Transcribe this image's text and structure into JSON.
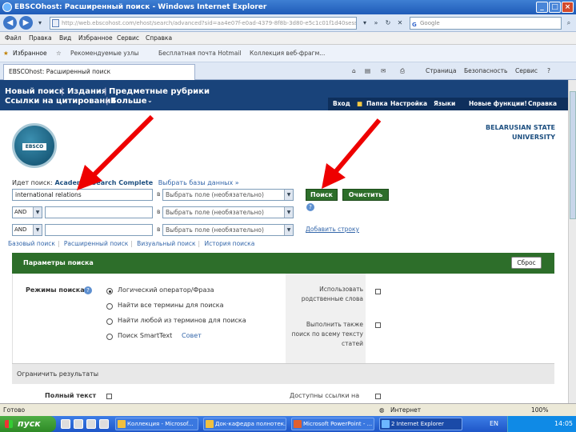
{
  "window": {
    "title": "EBSCOhost: Расширенный поиск - Windows Internet Explorer",
    "minimize": "_",
    "maximize": "□",
    "close": "×"
  },
  "browser": {
    "address": "http://web.ebscohost.com/ehost/search/advanced?sid=aa4e07f-e0ad-4379-8f8b-3d80-e5c1c01f1d40sess",
    "search_placeholder": "Google",
    "menu": [
      "Файл",
      "Правка",
      "Вид",
      "Избранное",
      "Сервис",
      "Справка"
    ],
    "favorites_label": "Избранное",
    "favorites": [
      "Рекомендуемые узлы",
      "Бесплатная почта Hotmail",
      "Коллекция веб-фрагм..."
    ],
    "tab_title": "EBSCOhost: Расширенный поиск",
    "commands": [
      "Страница",
      "Безопасность",
      "Сервис"
    ]
  },
  "ebsco": {
    "nav_top": [
      "Новый поиск",
      "Издания",
      "Предметные рубрики"
    ],
    "nav_bottom": [
      "Ссылки на цитирования",
      "Больше"
    ],
    "toolbar": [
      "Вход",
      "Папка",
      "Настройка",
      "Языки",
      "Новые функции!",
      "Справка"
    ],
    "logo_text": "EBSCO",
    "university": [
      "BELARUSIAN STATE",
      "UNIVERSITY"
    ],
    "searching_label": "Идет поиск:",
    "database": "Academic Search Complete",
    "choose_db": "Выбрать базы данных »",
    "rows": [
      {
        "bool": "",
        "term": "international relations",
        "field": "Выбрать поле (необязательно)"
      },
      {
        "bool": "AND",
        "term": "",
        "field": "Выбрать поле (необязательно)"
      },
      {
        "bool": "AND",
        "term": "",
        "field": "Выбрать поле (необязательно)"
      }
    ],
    "in_label": "в",
    "search_btn": "Поиск",
    "clear_btn": "Очистить",
    "help": "?",
    "add_row": "Добавить строку",
    "sublinks": [
      "Базовый поиск",
      "Расширенный поиск",
      "Визуальный поиск",
      "История поиска"
    ],
    "options_title": "Параметры поиска",
    "reset_btn": "Сброс",
    "search_modes_label": "Режимы поиска",
    "modes": [
      "Логический оператор/Фраза",
      "Найти все термины для поиска",
      "Найти любой из терминов для поиска",
      "Поиск SmartText"
    ],
    "smarttext_hint": "Совет",
    "related_words": [
      "Использовать",
      "родственные слова"
    ],
    "also_search": [
      "Выполнить также",
      "поиск по всему тексту",
      "статей"
    ],
    "limit_title": "Ограничить результаты",
    "fulltext_label": "Полный текст",
    "refs_label": "Доступны ссылки на"
  },
  "status": {
    "text": "Готово",
    "zone": "Интернет",
    "zoom": "100%"
  },
  "taskbar": {
    "start": "пуск",
    "buttons": [
      "Коллекция - Microsof...",
      "Док-кафедра полнотек...",
      "Microsoft PowerPoint - ...",
      "2 Internet Explorer"
    ],
    "lang": "EN",
    "clock": "14:05"
  }
}
